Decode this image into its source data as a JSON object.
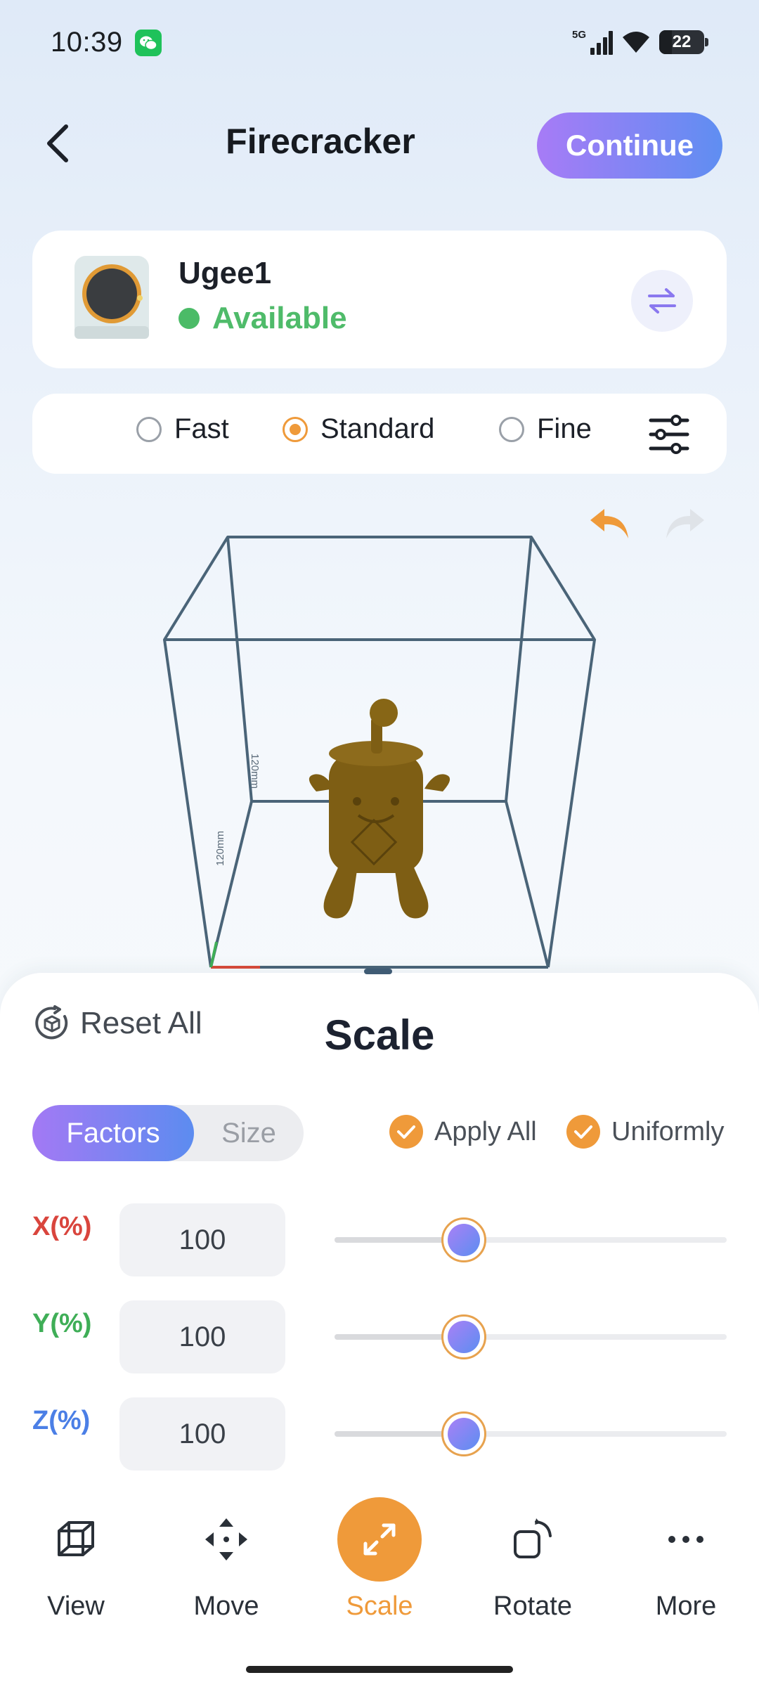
{
  "status_bar": {
    "time": "10:39",
    "network": "5G",
    "battery": "22"
  },
  "header": {
    "title": "Firecracker",
    "continue_label": "Continue"
  },
  "printer": {
    "name": "Ugee1",
    "status": "Available",
    "status_color": "#4fbb6a"
  },
  "quality": {
    "options": [
      {
        "label": "Fast",
        "selected": false
      },
      {
        "label": "Standard",
        "selected": true
      },
      {
        "label": "Fine",
        "selected": false
      }
    ]
  },
  "viewport": {
    "dim_label_1": "120mm",
    "dim_label_2": "120mm",
    "model_color": "#7a5a12"
  },
  "sheet": {
    "reset_label": "Reset All",
    "title": "Scale",
    "mode_tabs": [
      {
        "label": "Factors",
        "active": true
      },
      {
        "label": "Size",
        "active": false
      }
    ],
    "apply_all_label": "Apply All",
    "uniformly_label": "Uniformly",
    "axes": [
      {
        "label": "X(%)",
        "value": "100",
        "color": "#d9453d",
        "slider_fraction": 0.33
      },
      {
        "label": "Y(%)",
        "value": "100",
        "color": "#3fae57",
        "slider_fraction": 0.33
      },
      {
        "label": "Z(%)",
        "value": "100",
        "color": "#4b7fe6",
        "slider_fraction": 0.33
      }
    ]
  },
  "nav": [
    {
      "label": "View",
      "icon": "cube-icon",
      "active": false
    },
    {
      "label": "Move",
      "icon": "move-arrows-icon",
      "active": false
    },
    {
      "label": "Scale",
      "icon": "expand-icon",
      "active": true
    },
    {
      "label": "Rotate",
      "icon": "rotate-icon",
      "active": false
    },
    {
      "label": "More",
      "icon": "more-dots-icon",
      "active": false
    }
  ],
  "colors": {
    "accent_orange": "#ef9a3a",
    "accent_gradient_start": "#a77bf6",
    "accent_gradient_end": "#5f8ef2"
  }
}
